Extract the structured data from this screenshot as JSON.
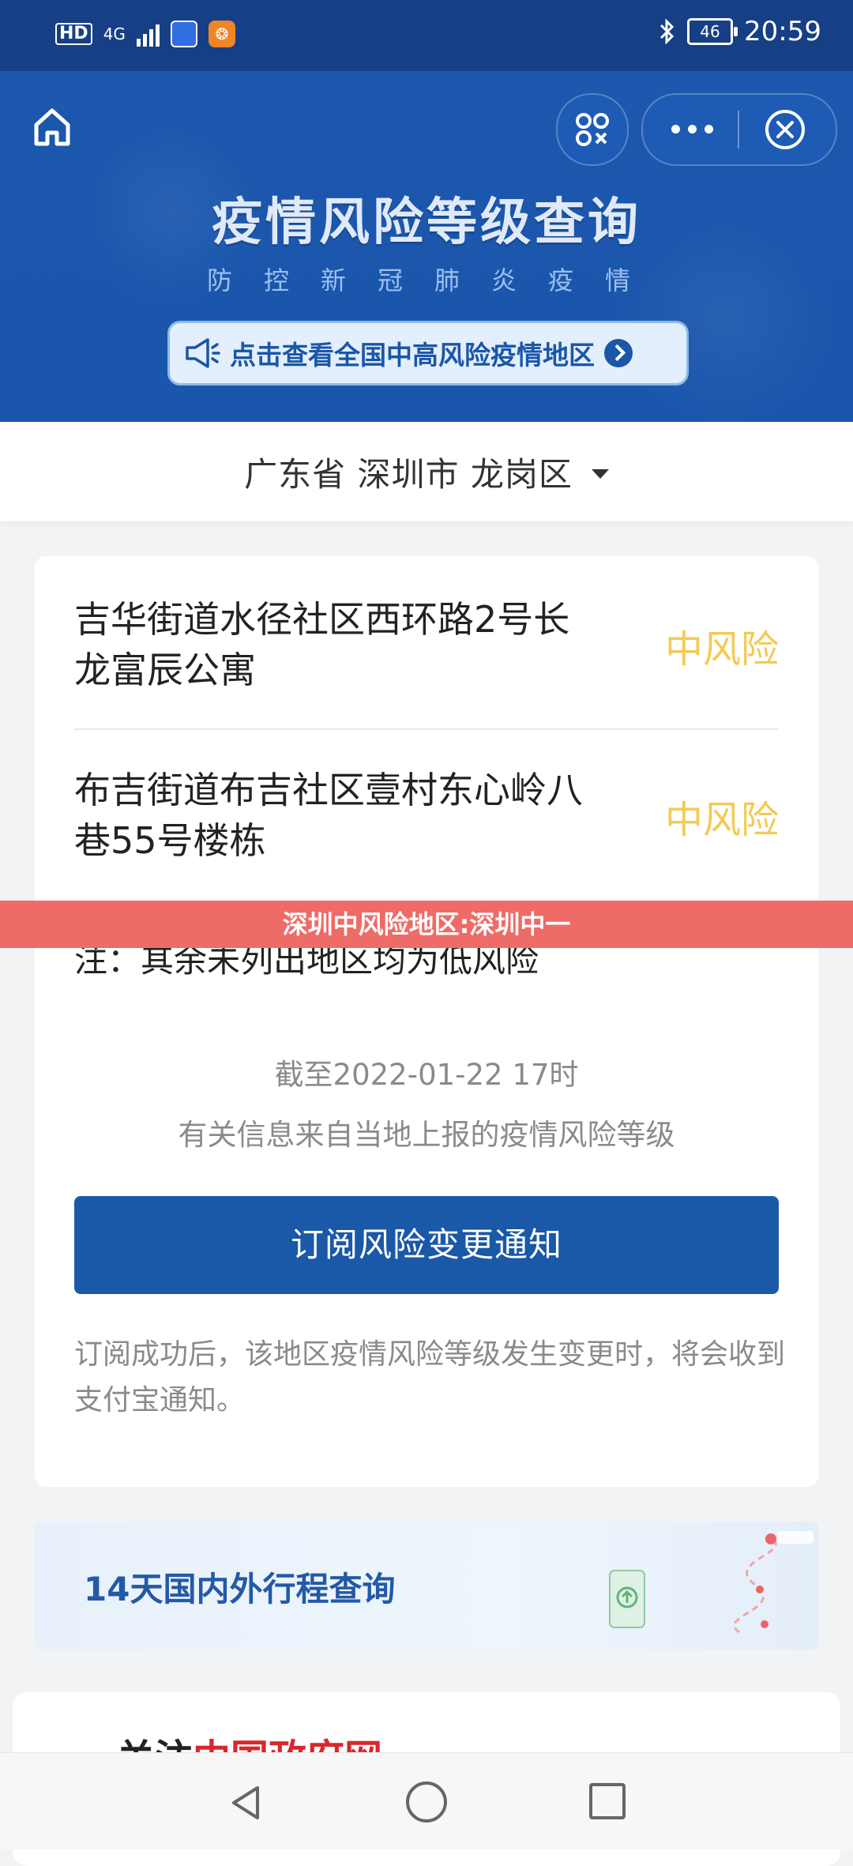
{
  "status_bar": {
    "hd_label": "HD",
    "network_label": "4G",
    "battery": "46",
    "time": "20:59"
  },
  "header": {
    "title": "疫情风险等级查询",
    "subtitle": "防控新冠肺炎疫情",
    "notice": "点击查看全国中高风险疫情地区",
    "icons": [
      "home-icon",
      "qr-scan-icon",
      "more-icon",
      "close-icon",
      "megaphone-icon",
      "chevron-right-icon"
    ]
  },
  "region": {
    "label": "广东省 深圳市 龙岗区"
  },
  "risk_list": [
    {
      "address": "吉华街道水径社区西环路2号长龙富辰公寓",
      "level": "中风险"
    },
    {
      "address": "布吉街道布吉社区壹村东心岭八巷55号楼栋",
      "level": "中风险"
    }
  ],
  "overlay_banner": "深圳中风险地区:深圳中一",
  "note": "注：其余未列出地区均为低风险",
  "as_of": "截至2022-01-22 17时",
  "source_note": "有关信息来自当地上报的疫情风险等级",
  "subscribe_button": "订阅风险变更通知",
  "subscribe_tip": "订阅成功后，该地区疫情风险等级发生变更时，将会收到支付宝通知。",
  "trip_banner": {
    "title": "14天国内外行程查询"
  },
  "gov_card": {
    "prefix": "关注",
    "name": "中国政府网"
  },
  "colors": {
    "header_blue": "#1a56ac",
    "risk_medium": "#f2cb55",
    "button_blue": "#1a58a8",
    "overlay_red": "#ee6b67",
    "gov_red": "#d8272d"
  }
}
